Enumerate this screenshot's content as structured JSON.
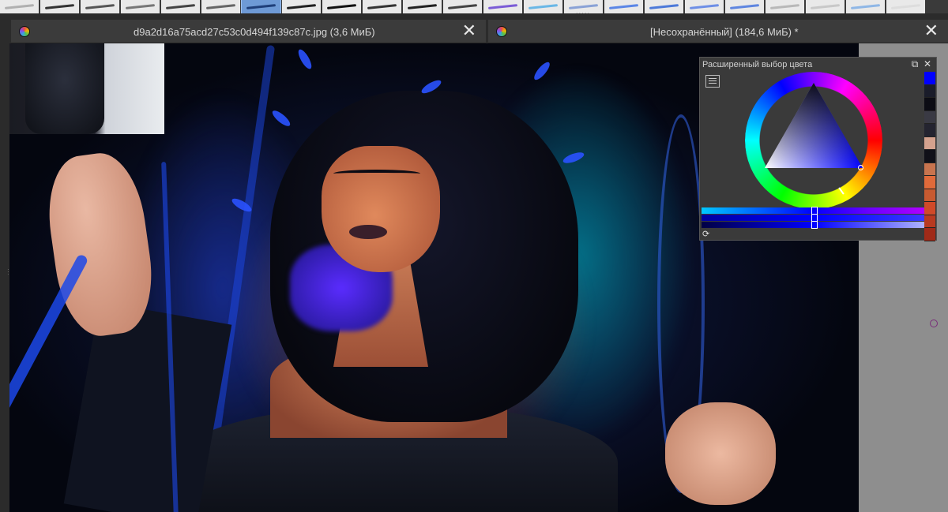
{
  "brush_presets": {
    "selected_index": 6,
    "items": [
      {
        "name": "preset-1",
        "stroke": "#b0b0b0"
      },
      {
        "name": "preset-2",
        "stroke": "#333"
      },
      {
        "name": "preset-3",
        "stroke": "#555"
      },
      {
        "name": "preset-4",
        "stroke": "#777"
      },
      {
        "name": "preset-5",
        "stroke": "#444"
      },
      {
        "name": "preset-6",
        "stroke": "#666"
      },
      {
        "name": "preset-7",
        "stroke": "#1f3f7a"
      },
      {
        "name": "preset-8",
        "stroke": "#222"
      },
      {
        "name": "preset-9",
        "stroke": "#111"
      },
      {
        "name": "preset-10",
        "stroke": "#333"
      },
      {
        "name": "preset-11",
        "stroke": "#222"
      },
      {
        "name": "preset-12",
        "stroke": "#444"
      },
      {
        "name": "preset-13",
        "stroke": "#7b5cd6"
      },
      {
        "name": "preset-14",
        "stroke": "#6ab7e6"
      },
      {
        "name": "preset-15",
        "stroke": "#8aa2d6"
      },
      {
        "name": "preset-16",
        "stroke": "#5b86e6"
      },
      {
        "name": "preset-17",
        "stroke": "#4d7ad9"
      },
      {
        "name": "preset-18",
        "stroke": "#6e8fe6"
      },
      {
        "name": "preset-19",
        "stroke": "#5f86e0"
      },
      {
        "name": "preset-20",
        "stroke": "#b8b8b8"
      },
      {
        "name": "preset-21",
        "stroke": "#c8c8c8"
      },
      {
        "name": "preset-22",
        "stroke": "#8fb7e6"
      },
      {
        "name": "preset-23",
        "stroke": "#dddddd"
      }
    ]
  },
  "tabs": [
    {
      "title": "d9a2d16a75acd27c53c0d494f139c87c.jpg (3,6 МиБ)",
      "close": "✕"
    },
    {
      "title": "[Несохранённый]  (184,6 МиБ) *",
      "close": "✕"
    }
  ],
  "color_docker": {
    "title": "Расширенный выбор цвета",
    "float_icon": "⧉",
    "close_icon": "✕",
    "refresh_icon": "⟳",
    "current_color": "#1a1aff",
    "palette": [
      "#0000ff",
      "#1a1c2a",
      "#0c0c14",
      "#3a3a44",
      "#242430",
      "#d4a28e",
      "#101018",
      "#c8744e",
      "#e06a3a",
      "#c85a30",
      "#d04a28",
      "#b83a20",
      "#a02a18"
    ]
  }
}
